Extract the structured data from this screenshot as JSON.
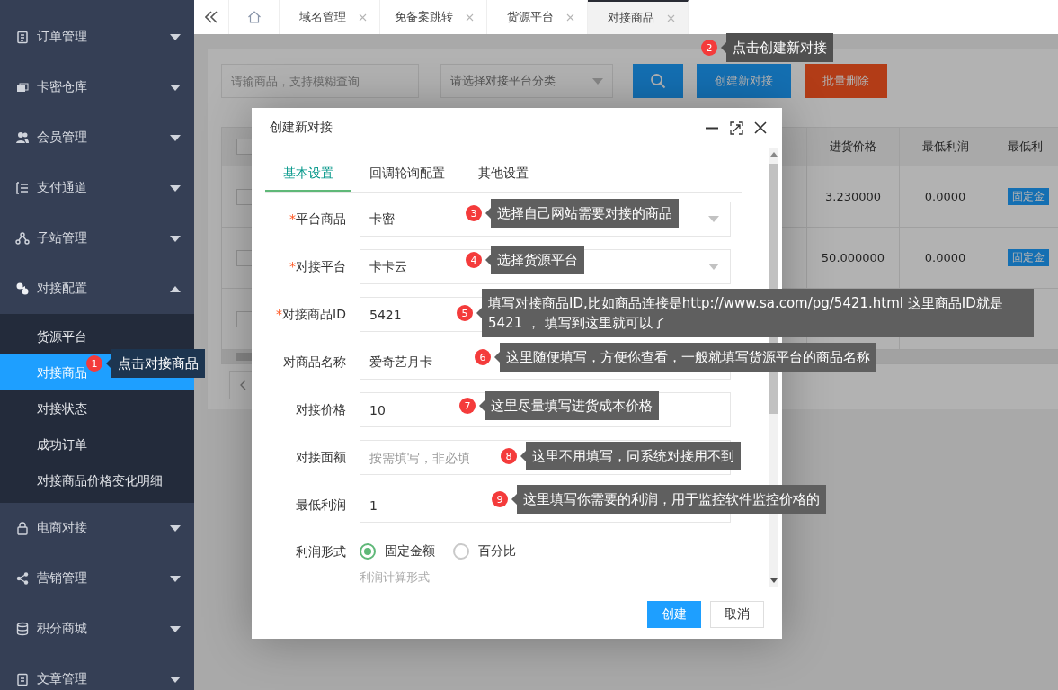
{
  "sidebar": {
    "items": [
      {
        "label": "订单管理",
        "expanded": false
      },
      {
        "label": "卡密仓库",
        "expanded": false
      },
      {
        "label": "会员管理",
        "expanded": false
      },
      {
        "label": "支付通道",
        "expanded": false
      },
      {
        "label": "子站管理",
        "expanded": false
      },
      {
        "label": "对接配置",
        "expanded": true,
        "children": [
          {
            "label": "货源平台",
            "selected": false
          },
          {
            "label": "对接商品",
            "selected": true
          },
          {
            "label": "对接状态",
            "selected": false
          },
          {
            "label": "成功订单",
            "selected": false
          },
          {
            "label": "对接商品价格变化明细",
            "selected": false
          }
        ]
      },
      {
        "label": "电商对接",
        "expanded": false
      },
      {
        "label": "营销管理",
        "expanded": false
      },
      {
        "label": "积分商城",
        "expanded": false
      },
      {
        "label": "文章管理",
        "expanded": false
      }
    ]
  },
  "tabs": [
    {
      "label": "域名管理",
      "selected": false
    },
    {
      "label": "免备案跳转",
      "selected": false
    },
    {
      "label": "货源平台",
      "selected": false
    },
    {
      "label": "对接商品",
      "selected": true
    }
  ],
  "toolbar": {
    "search_placeholder": "请输商品，支持模糊查询",
    "select_placeholder": "请选择对接平台分类",
    "create_button": "创建新对接",
    "delete_button": "批量删除"
  },
  "table": {
    "select_all_checked": false,
    "columns": [
      "进货价格",
      "最低利润",
      "最低利"
    ],
    "rows": [
      {
        "checked": false,
        "price": "3.230000",
        "profit": "0.0000",
        "tag": "固定金"
      },
      {
        "checked": false,
        "price": "50.000000",
        "profit": "0.0000",
        "tag": "固定金"
      },
      {
        "checked": false
      }
    ]
  },
  "dialog": {
    "title": "创建新对接",
    "tabs": [
      {
        "label": "基本设置",
        "selected": true
      },
      {
        "label": "回调轮询配置",
        "selected": false
      },
      {
        "label": "其他设置",
        "selected": false
      }
    ],
    "fields": [
      {
        "kind": "select",
        "mark": "*",
        "label": "平台商品",
        "value": "卡密"
      },
      {
        "kind": "select",
        "mark": "*",
        "label": "对接平台",
        "value": "卡卡云"
      },
      {
        "kind": "input",
        "mark": "*",
        "label": "对接商品ID",
        "value": "5421"
      },
      {
        "kind": "input",
        "label": "对商品名称",
        "value": "爱奇艺月卡"
      },
      {
        "kind": "input",
        "label": "对接价格",
        "value": "10"
      },
      {
        "kind": "input",
        "label": "对接面额",
        "placeholder": "按需填写，非必填"
      },
      {
        "kind": "input",
        "label": "最低利润",
        "value": "1"
      },
      {
        "kind": "radio",
        "label": "利润形式",
        "options": [
          {
            "label": "固定金额",
            "selected": true
          },
          {
            "label": "百分比",
            "selected": false
          }
        ],
        "hint": "利润计算形式"
      }
    ],
    "buttons": [
      "创建",
      "取消"
    ]
  },
  "callouts": [
    {
      "number": "1",
      "text": "点击对接商品"
    },
    {
      "number": "2",
      "text": "点击创建新对接"
    },
    {
      "number": "3",
      "text": "选择自己网站需要对接的商品"
    },
    {
      "number": "4",
      "text": "选择货源平台"
    },
    {
      "number": "5",
      "text": "填写对接商品ID,比如商品连接是http://www.sa.com/pg/5421.html 这里商品ID就是5421 ， 填写到这里就可以了"
    },
    {
      "number": "6",
      "text": "这里随便填写，方便你查看，一般就填写货源平台的商品名称"
    },
    {
      "number": "7",
      "text": "这里尽量填写进货成本价格"
    },
    {
      "number": "8",
      "text": "这里不用填写，同系统对接用不到"
    },
    {
      "number": "9",
      "text": "这里填写你需要的利润，用于监控软件监控价格的"
    }
  ]
}
